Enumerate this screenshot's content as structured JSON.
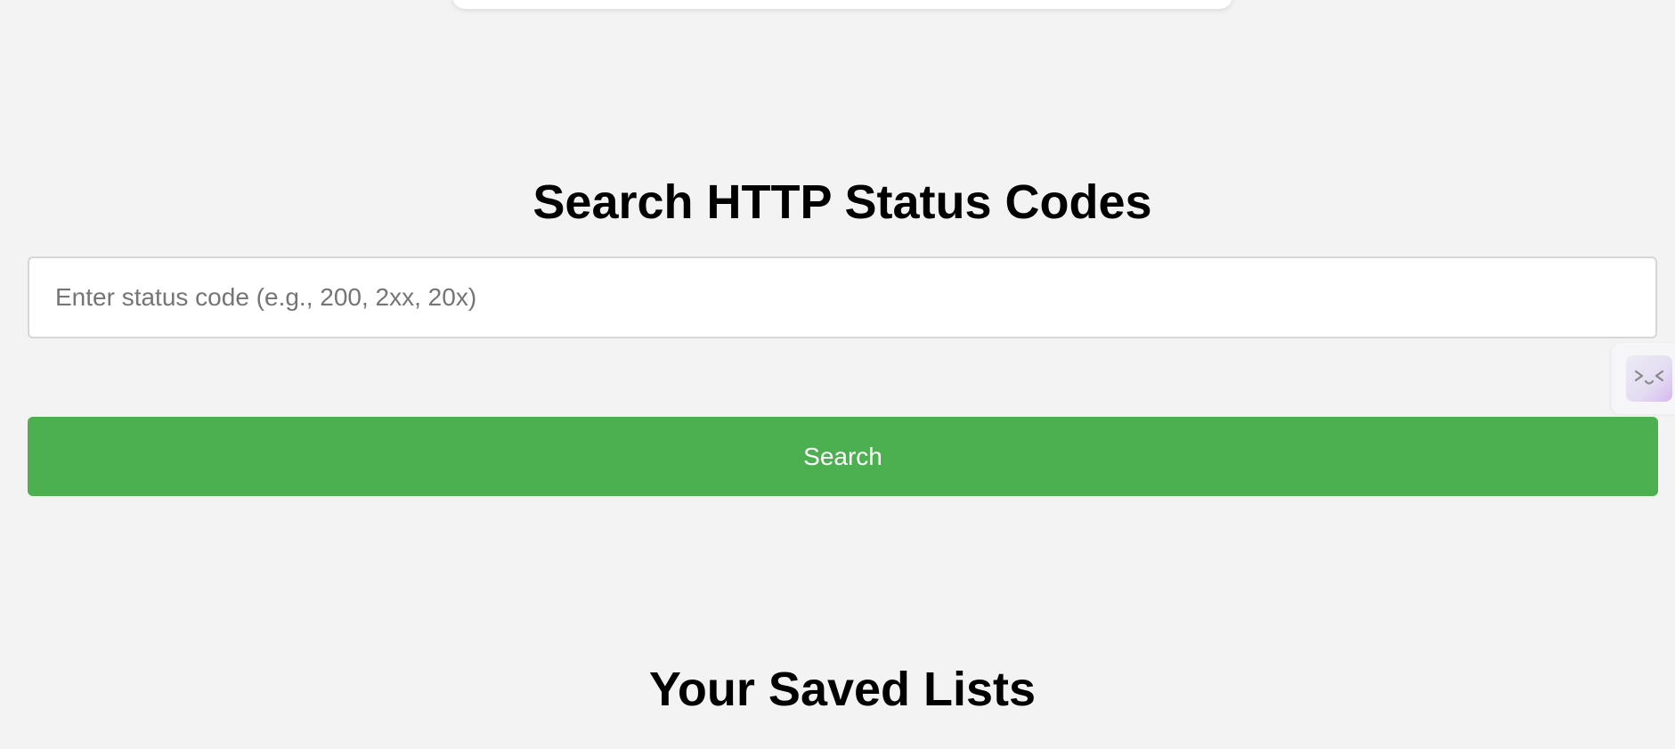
{
  "search_section": {
    "title": "Search HTTP Status Codes",
    "input_placeholder": "Enter status code (e.g., 200, 2xx, 20x)",
    "input_value": "",
    "button_label": "Search"
  },
  "side_widget": {
    "icon": "face-icon"
  },
  "saved_section": {
    "title": "Your Saved Lists"
  },
  "colors": {
    "background": "#f3f3f3",
    "button": "#4caf50",
    "button_text": "#ffffff"
  }
}
